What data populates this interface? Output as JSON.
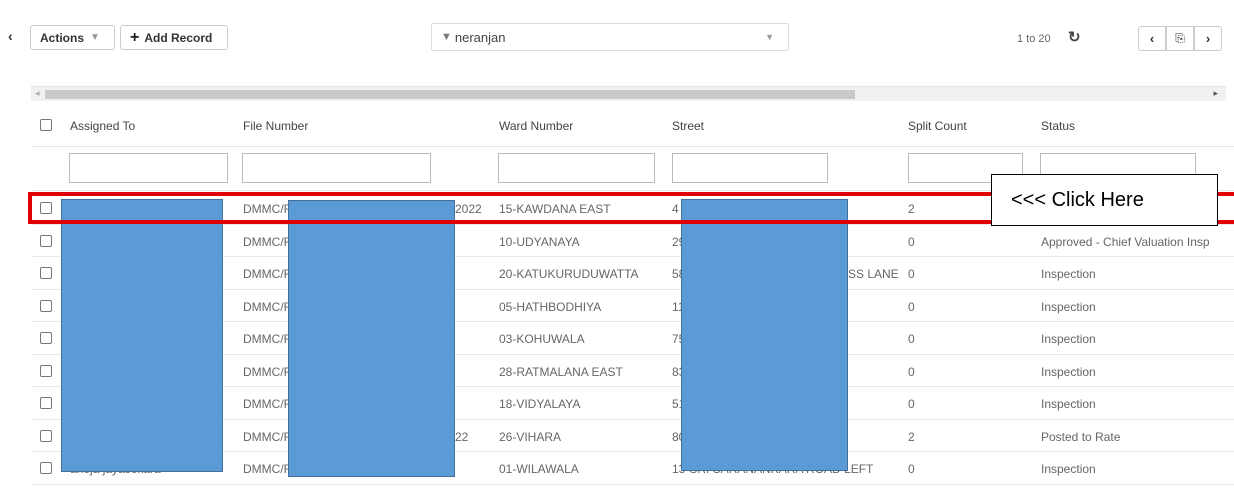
{
  "toolbar": {
    "collapse_icon": "‹",
    "actions_label": "Actions",
    "add_record_label": "Add Record",
    "filter_value": "neranjan",
    "pager_text": "1 to 20"
  },
  "columns": [
    "Assigned To",
    "File Number",
    "Ward Number",
    "Street",
    "Split Count",
    "Status"
  ],
  "rows": [
    {
      "assigned": "",
      "file": "DMMC/F",
      "file_tail": "2022",
      "ward": "15-KAWDANA EAST",
      "street": "4",
      "street_tail": "",
      "split": "2",
      "status": ""
    },
    {
      "assigned": "",
      "file": "DMMC/F",
      "file_tail": "",
      "ward": "10-UDYANAYA",
      "street": "29",
      "street_tail": "",
      "split": "0",
      "status": "Approved - Chief Valuation Insp"
    },
    {
      "assigned": "",
      "file": "DMMC/F",
      "file_tail": "",
      "ward": "20-KATUKURUDUWATTA",
      "street": "58",
      "street_tail": "SS LANE",
      "split": "0",
      "status": "Inspection"
    },
    {
      "assigned": "",
      "file": "DMMC/F",
      "file_tail": "",
      "ward": "05-HATHBODHIYA",
      "street": "11",
      "street_tail": "",
      "split": "0",
      "status": "Inspection"
    },
    {
      "assigned": "",
      "file": "DMMC/F",
      "file_tail": "",
      "ward": "03-KOHUWALA",
      "street": "75",
      "street_tail": "",
      "split": "0",
      "status": "Inspection"
    },
    {
      "assigned": "",
      "file": "DMMC/F",
      "file_tail": "",
      "ward": "28-RATMALANA EAST",
      "street": "83",
      "street_tail": "",
      "split": "0",
      "status": "Inspection"
    },
    {
      "assigned": "",
      "file": "DMMC/F",
      "file_tail": "",
      "ward": "18-VIDYALAYA",
      "street": "51",
      "street_tail": "",
      "split": "0",
      "status": "Inspection"
    },
    {
      "assigned": "",
      "file": "DMMC/F",
      "file_tail": "22",
      "ward": "26-VIHARA",
      "street": "80",
      "street_tail": "",
      "split": "2",
      "status": "Posted to Rate"
    },
    {
      "assigned": "anoja jayasekara",
      "file": "DMMC/R/REV/CM/5311/13/2022",
      "file_tail": "",
      "ward": "01-WILAWALA",
      "street": "13-SRI SARANANKARA ROAD LEFT",
      "street_tail": "",
      "split": "0",
      "status": "Inspection"
    }
  ],
  "callout_text": "<<< Click Here",
  "colors": {
    "highlight": "#e00000",
    "redaction": "#5b9bd5"
  }
}
